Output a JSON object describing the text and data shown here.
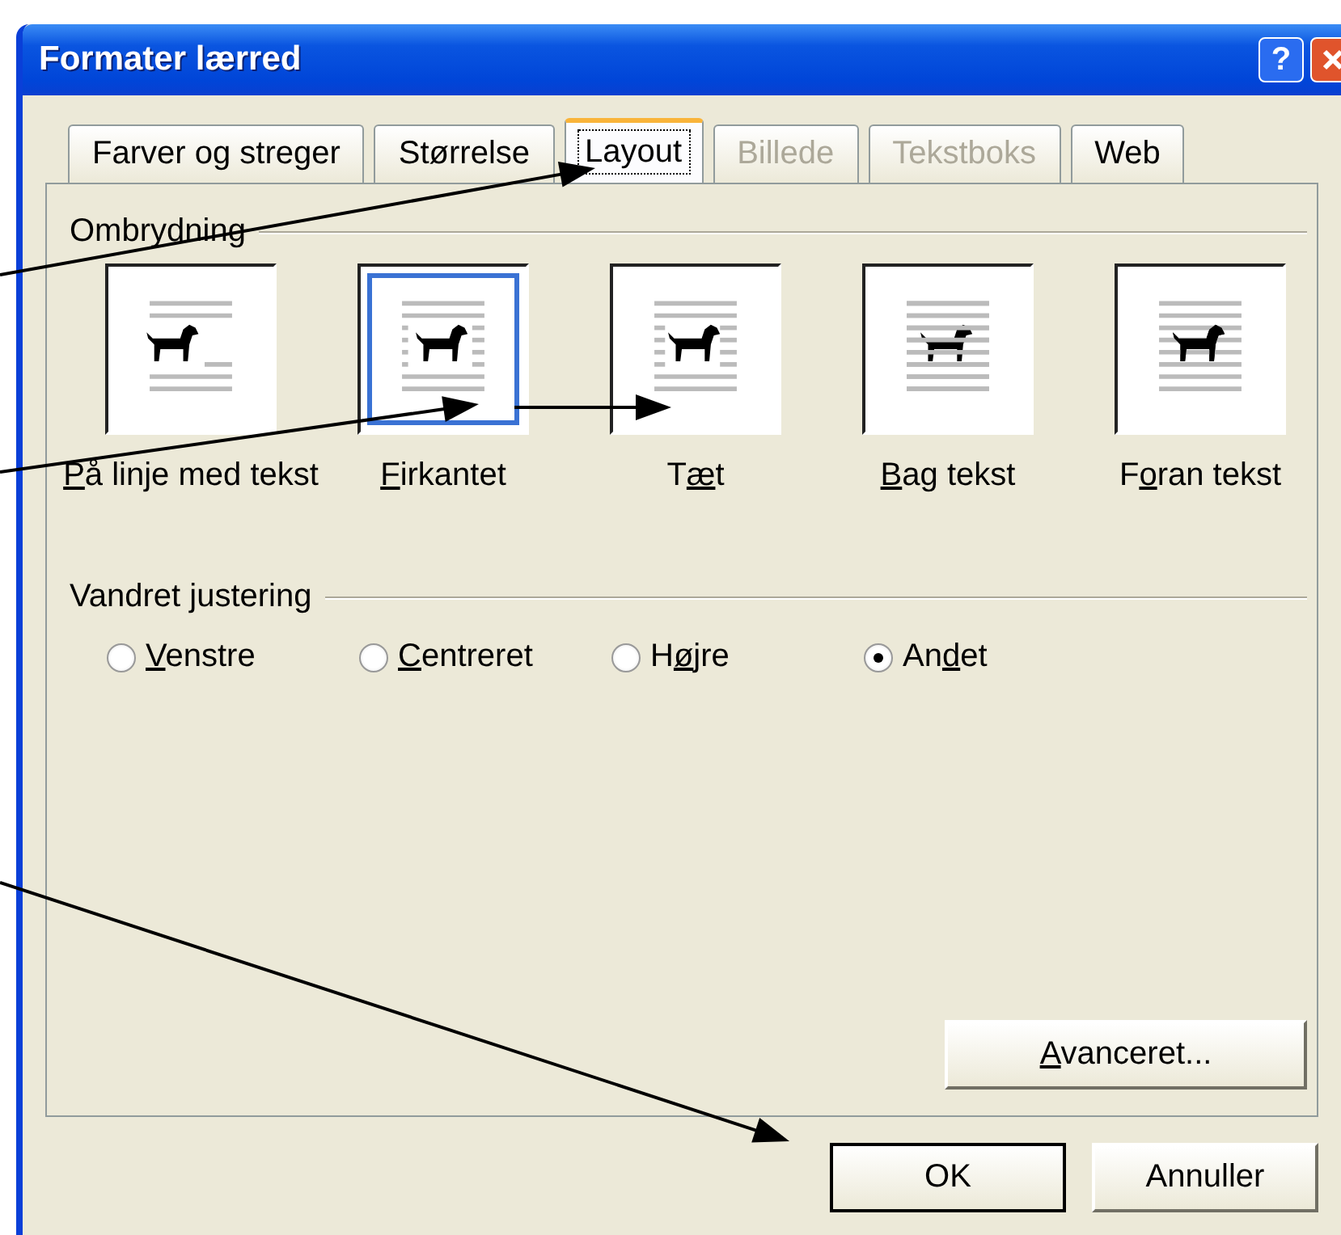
{
  "window": {
    "title": "Formater lærred",
    "help_button": "?"
  },
  "tabs": [
    {
      "label": "Farver og streger",
      "selected": false,
      "disabled": false
    },
    {
      "label": "Størrelse",
      "selected": false,
      "disabled": false
    },
    {
      "label": "Layout",
      "selected": true,
      "disabled": false
    },
    {
      "label": "Billede",
      "selected": false,
      "disabled": true
    },
    {
      "label": "Tekstboks",
      "selected": false,
      "disabled": true
    },
    {
      "label": "Web",
      "selected": false,
      "disabled": false
    }
  ],
  "wrapping": {
    "heading": "Ombrydning",
    "options": [
      {
        "access_key": "P",
        "label_end": "å linje med tekst",
        "kind": "inline",
        "selected": false
      },
      {
        "access_key": "F",
        "label_end": "irkantet",
        "kind": "square",
        "selected": true
      },
      {
        "label_start": "T",
        "access_key": "æ",
        "label_end": "t",
        "kind": "tight",
        "selected": false
      },
      {
        "access_key": "B",
        "label_end": "ag tekst",
        "kind": "behind",
        "selected": false
      },
      {
        "label_start": "F",
        "access_key": "o",
        "label_end": "ran tekst",
        "kind": "front",
        "selected": false
      }
    ]
  },
  "horizontal_alignment": {
    "heading": "Vandret justering",
    "options": [
      {
        "access_key": "V",
        "label_end": "enstre",
        "selected": false
      },
      {
        "access_key": "C",
        "label_end": "entreret",
        "selected": false
      },
      {
        "label_start": "H",
        "access_key": "ø",
        "label_end": "jre",
        "selected": false
      },
      {
        "label_start": "An",
        "access_key": "d",
        "label_end": "et",
        "selected": true
      }
    ]
  },
  "advanced_button": {
    "access_key": "A",
    "label_end": "vanceret..."
  },
  "buttons": [
    {
      "label": "OK",
      "default": true
    },
    {
      "label": "Annuller",
      "default": false
    }
  ]
}
